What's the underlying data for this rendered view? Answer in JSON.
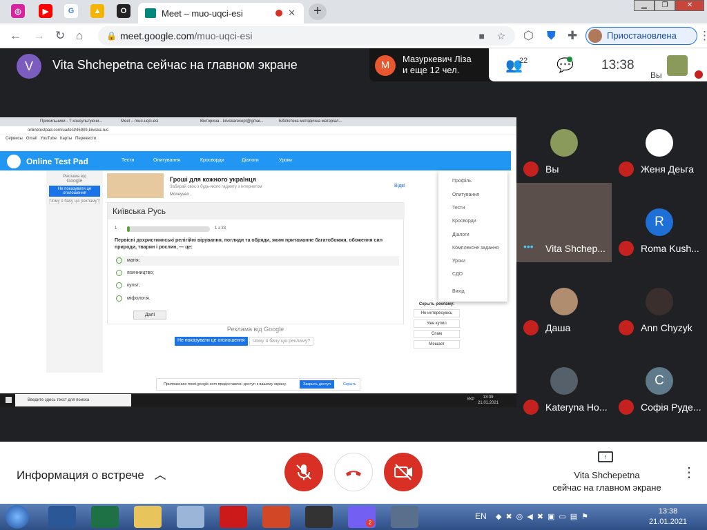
{
  "browser": {
    "active_tab_title": "Meet – muo-uqci-esi",
    "url_domain": "meet.google.com",
    "url_path": "/muo-uqci-esi",
    "profile_status": "Приостановлена",
    "new_tab": "+"
  },
  "meet": {
    "presenter_initial": "V",
    "presenter_banner": "Vita Shchepetna сейчас на главном экране",
    "raised_initial": "M",
    "raised_line1": "Мазуркевич Ліза",
    "raised_line2": "и еще 12 чел.",
    "participant_count": "22",
    "clock": "13:38",
    "self_label": "Вы",
    "meeting_info": "Информация о встрече",
    "presenting_line1": "Vita Shchepetna",
    "presenting_line2": "сейчас на главном экране",
    "participants": [
      {
        "name": "Вы",
        "initial": "",
        "color": "#8a9a5b"
      },
      {
        "name": "Женя Деьга",
        "initial": "",
        "color": "#ffffff"
      },
      {
        "name": "Vita Shchep...",
        "initial": "",
        "color": "#7d6a64"
      },
      {
        "name": "Roma Kush...",
        "initial": "R",
        "color": "#1e6fd6"
      },
      {
        "name": "Даша",
        "initial": "",
        "color": "#b08d6e"
      },
      {
        "name": "Ann Chyzyk",
        "initial": "",
        "color": "#3a2f2c"
      },
      {
        "name": "Kateryna Ho...",
        "initial": "",
        "color": "#55606a"
      },
      {
        "name": "Софія Руде...",
        "initial": "C",
        "color": "#5f7a8a"
      }
    ]
  },
  "shared_screen": {
    "tab1": "Прихильники - Т консультуючи...",
    "tab2": "Meet – muo-uqci-esi",
    "tab3": "Вікторина - kiivskarecept@gmai...",
    "tab4": "Бібліотека методична матеріал...",
    "url": "onlinetestpad.com/ua/test/45909-kiivska-rus",
    "bookmarks": [
      "Сервисы",
      "Gmail",
      "YouTube",
      "Карты",
      "Перевести"
    ],
    "brand": "Online Test Pad",
    "nav": [
      "Тести",
      "Опитування",
      "Кросворди",
      "Діалоги",
      "Уроки"
    ],
    "ad_title": "Гроші для кожного українця",
    "ad_sub": "Забирай своє з будь-якого гаджету з інтернетом",
    "ad_brand": "Moneyveo",
    "ad_link": "Відві",
    "left_ad_label": "Реклама від",
    "left_ad_brand": "Google",
    "left_ad_btn": "Не показувати це оголошення",
    "left_ad_why": "Чому я бачу цю рекламу?",
    "quiz_title": "Київська Русь",
    "question_num": "1",
    "progress_label": "1 з 33",
    "question": "Первісні дохристиянські релігійні вірування, погляди та обряди, яким притаманне багатобожжя, обоження сил природи, тварин і рослин, — це:",
    "options": [
      "магія;",
      "язичництво;",
      "культ;",
      "міфологія."
    ],
    "next_btn": "Далі",
    "ad_footer_label": "Реклама від",
    "ad_footer_brand": "Google",
    "ad_footer_btn": "Не показувати це оголошення",
    "ad_footer_why": "Чому я бачу цю рекламу?",
    "dropdown": [
      "Профіль",
      "Опитування",
      "Тести",
      "Кросворди",
      "Діалоги",
      "Комплексне задання",
      "Уроки",
      "СДО",
      "Вихід"
    ],
    "hide_ad_title": "Скрыть рекламу:",
    "hide_ad_options": [
      "Не интересуюсь",
      "Уже купил",
      "Спам",
      "Мешает"
    ],
    "share_notice": "Приложению meet.google.com предоставлен доступ к вашему экрану.",
    "share_stop": "Закрыть доступ",
    "share_hide": "Скрыть",
    "search_placeholder": "Введите здесь текст для поиска",
    "tray_time": "13:39",
    "tray_date": "21.01.2021",
    "tray_lang": "УКР"
  },
  "taskbar": {
    "lang": "EN",
    "time": "13:38",
    "date": "21.01.2021",
    "viber_badge": "2"
  }
}
